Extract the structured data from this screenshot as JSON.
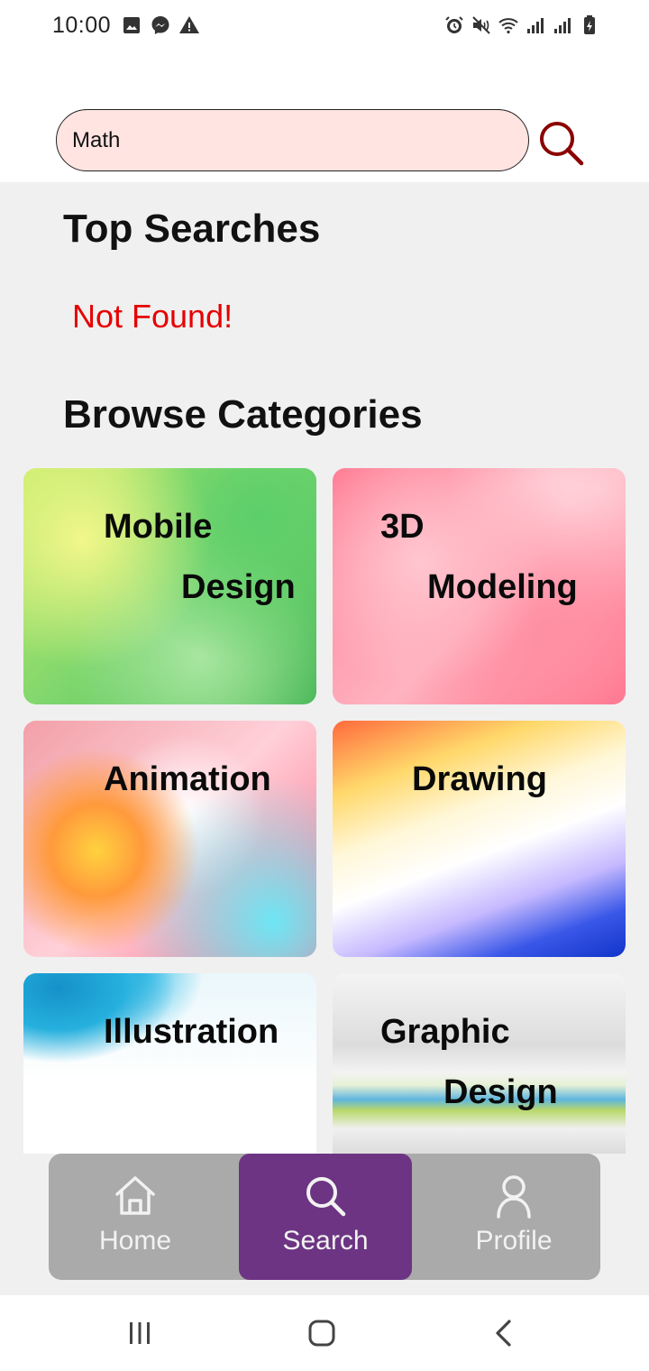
{
  "status_bar": {
    "time": "10:00",
    "left_icons": [
      "image-icon",
      "messenger-icon",
      "warning-icon"
    ],
    "right_icons": [
      "alarm-icon",
      "mute-icon",
      "wifi-icon",
      "signal-icon",
      "signal-icon",
      "battery-charging-icon"
    ]
  },
  "search": {
    "value": "Math",
    "icon": "search-icon"
  },
  "top_searches": {
    "title": "Top Searches",
    "empty_message": "Not Found!"
  },
  "browse": {
    "title": "Browse Categories",
    "categories": [
      {
        "line1": "Mobile",
        "line2": "Design"
      },
      {
        "line1": "3D",
        "line2": "Modeling"
      },
      {
        "line1": "Animation"
      },
      {
        "line1": "Drawing"
      },
      {
        "line1": "Illustration"
      },
      {
        "line1": "Graphic",
        "line2": "Design"
      }
    ]
  },
  "bottom_nav": {
    "items": [
      {
        "label": "Home",
        "icon": "home-icon"
      },
      {
        "label": "Search",
        "icon": "search-icon",
        "active": true
      },
      {
        "label": "Profile",
        "icon": "profile-icon"
      }
    ],
    "active_color": "#6c3483",
    "bar_color": "#aaaaaa"
  },
  "colors": {
    "search_field_bg": "#ffe4e1",
    "search_icon": "#8b0000",
    "not_found": "#e60000",
    "content_bg": "#f0f0f0"
  }
}
